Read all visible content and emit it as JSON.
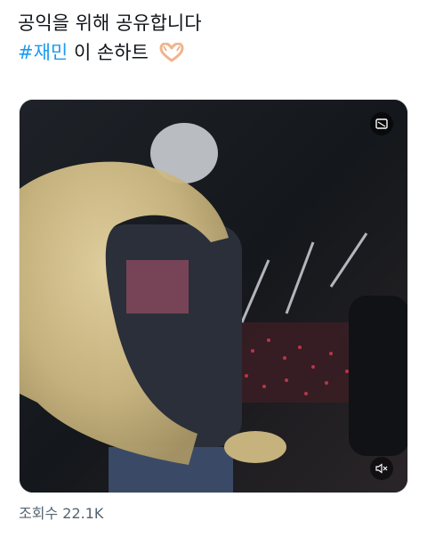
{
  "tweet": {
    "line1": "공익을 위해 공유합니다",
    "hashtag": "#재민",
    "line2_rest": "이 손하트",
    "emoji_icon": "heart-hands-icon"
  },
  "media": {
    "type": "video",
    "cc_icon": "captions-icon",
    "mute_icon": "muted-speaker-icon"
  },
  "stats": {
    "views_label": "조회수",
    "views_count": "22.1K"
  },
  "colors": {
    "hashtag": "#1d9bf0",
    "meta_text": "#536471",
    "text": "#0f1419"
  }
}
